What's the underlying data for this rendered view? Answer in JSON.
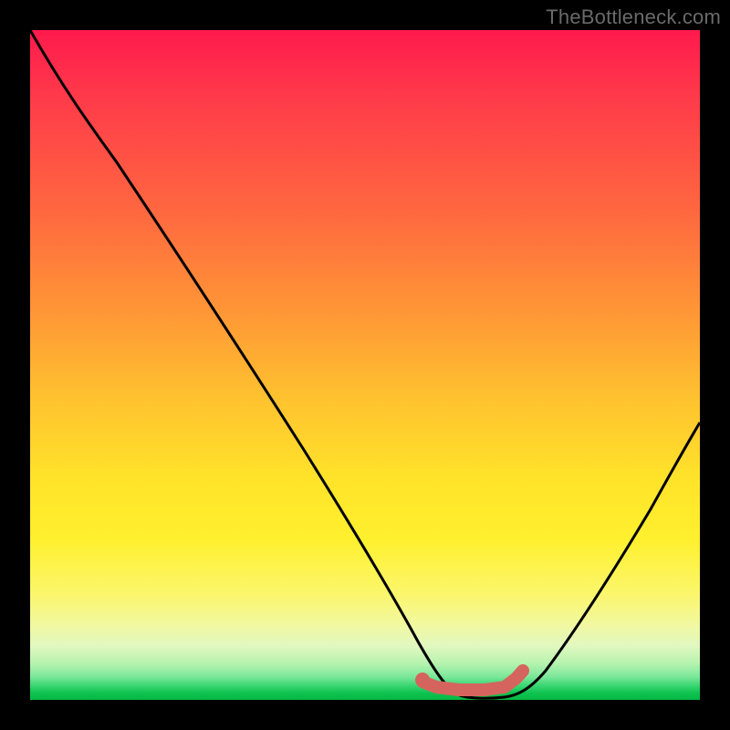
{
  "watermark": "TheBottleneck.com",
  "colors": {
    "curve": "#000000",
    "marker": "#d6645e",
    "frame": "#000000"
  },
  "chart_data": {
    "type": "line",
    "title": "",
    "xlabel": "",
    "ylabel": "",
    "xlim": [
      0,
      100
    ],
    "ylim": [
      0,
      100
    ],
    "grid": false,
    "legend": false,
    "series": [
      {
        "name": "bottleneck-curve",
        "x": [
          0,
          5,
          10,
          15,
          20,
          25,
          30,
          35,
          40,
          45,
          50,
          55,
          58,
          60,
          63,
          66,
          69,
          72,
          75,
          80,
          85,
          90,
          95,
          100
        ],
        "values": [
          100,
          92,
          85,
          79,
          72,
          65,
          58,
          50,
          43,
          35,
          26,
          15,
          8,
          4,
          1,
          0,
          0,
          1,
          4,
          12,
          22,
          33,
          45,
          58
        ]
      },
      {
        "name": "optimal-range-marker",
        "x": [
          58,
          60,
          62,
          64,
          66,
          68,
          70,
          72
        ],
        "values": [
          3,
          2,
          1.3,
          1,
          1,
          1.3,
          2,
          3
        ]
      }
    ],
    "annotations": []
  }
}
